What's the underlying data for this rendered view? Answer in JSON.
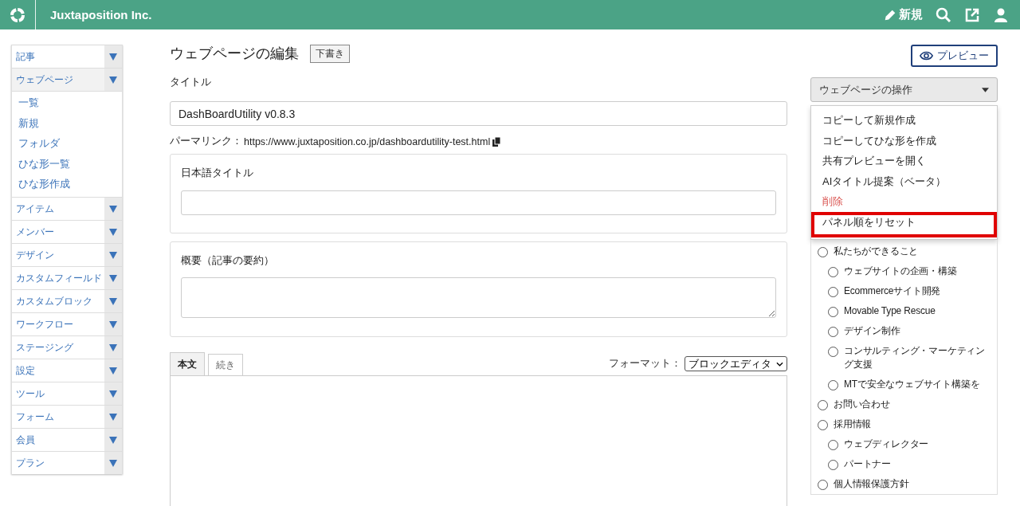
{
  "header": {
    "brand": "Juxtaposition Inc.",
    "new_label": "新規"
  },
  "sidebar": {
    "items": [
      {
        "label": "記事",
        "expanded": false
      },
      {
        "label": "ウェブページ",
        "expanded": true,
        "children": [
          {
            "label": "一覧"
          },
          {
            "label": "新規"
          },
          {
            "label": "フォルダ"
          },
          {
            "label": "ひな形一覧"
          },
          {
            "label": "ひな形作成"
          }
        ]
      },
      {
        "label": "アイテム",
        "expanded": false
      },
      {
        "label": "メンバー",
        "expanded": false
      },
      {
        "label": "デザイン",
        "expanded": false
      },
      {
        "label": "カスタムフィールド",
        "expanded": false
      },
      {
        "label": "カスタムブロック",
        "expanded": false
      },
      {
        "label": "ワークフロー",
        "expanded": false
      },
      {
        "label": "ステージング",
        "expanded": false
      },
      {
        "label": "設定",
        "expanded": false
      },
      {
        "label": "ツール",
        "expanded": false
      },
      {
        "label": "フォーム",
        "expanded": false
      },
      {
        "label": "会員",
        "expanded": false
      },
      {
        "label": "プラン",
        "expanded": false
      }
    ]
  },
  "page": {
    "title": "ウェブページの編集",
    "status_badge": "下書き"
  },
  "form": {
    "title_label": "タイトル",
    "title_value": "DashBoardUtility v0.8.3",
    "permalink_label": "パーマリンク：",
    "permalink_url": "https://www.juxtaposition.co.jp/dashboardutility-test.html",
    "ja_title_label": "日本語タイトル",
    "summary_label": "概要（記事の要約）",
    "tabs": [
      {
        "label": "本文",
        "selected": true
      },
      {
        "label": "続き",
        "selected": false
      }
    ],
    "format_label": "フォーマット：",
    "format_value": "ブロックエディタ"
  },
  "preview_button": "プレビュー",
  "actions": {
    "label": "ウェブページの操作",
    "items": [
      {
        "label": "コピーして新規作成",
        "kind": "normal",
        "highlighted": false
      },
      {
        "label": "コピーしてひな形を作成",
        "kind": "normal",
        "highlighted": false
      },
      {
        "label": "共有プレビューを開く",
        "kind": "normal",
        "highlighted": false
      },
      {
        "label": "AIタイトル提案（ベータ）",
        "kind": "normal",
        "highlighted": false
      },
      {
        "label": "削除",
        "kind": "danger",
        "highlighted": false
      },
      {
        "label": "パネル順をリセット",
        "kind": "normal",
        "highlighted": true
      }
    ]
  },
  "folders": [
    {
      "label": "私たちができること",
      "selected": false,
      "children": [
        {
          "label": "ウェブサイトの企画・構築",
          "selected": false
        },
        {
          "label": "Ecommerceサイト開発",
          "selected": false
        },
        {
          "label": "Movable Type Rescue",
          "selected": false
        },
        {
          "label": "デザイン制作",
          "selected": false
        },
        {
          "label": "コンサルティング・マーケティング支援",
          "selected": false
        },
        {
          "label": "MTで安全なウェブサイト構築を",
          "selected": false
        }
      ]
    },
    {
      "label": "お問い合わせ",
      "selected": false
    },
    {
      "label": "採用情報",
      "selected": false,
      "children": [
        {
          "label": "ウェブディレクター",
          "selected": false
        },
        {
          "label": "パートナー",
          "selected": false
        }
      ]
    },
    {
      "label": "個人情報保護方針",
      "selected": false
    }
  ]
}
